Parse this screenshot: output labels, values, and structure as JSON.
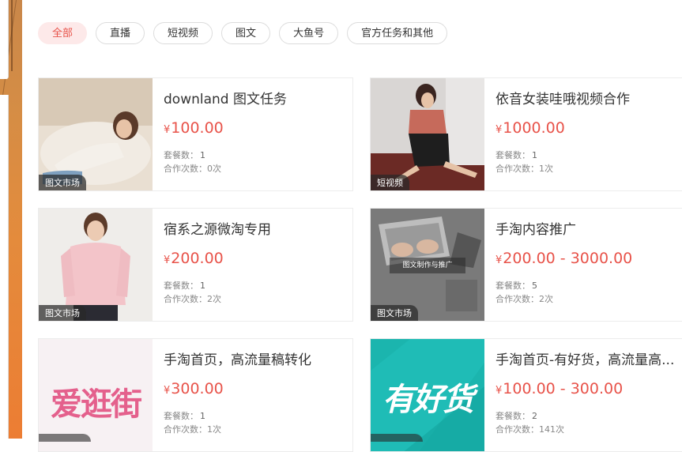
{
  "filters": [
    {
      "label": "全部",
      "active": true
    },
    {
      "label": "直播",
      "active": false
    },
    {
      "label": "短视频",
      "active": false
    },
    {
      "label": "图文",
      "active": false
    },
    {
      "label": "大鱼号",
      "active": false
    },
    {
      "label": "官方任务和其他",
      "active": false
    }
  ],
  "meta_labels": {
    "packages": "套餐数：",
    "times": "合作次数："
  },
  "currency": "¥",
  "cards": [
    {
      "title": "downland 图文任务",
      "price": "100.00",
      "packages": "1",
      "times": "0次",
      "tag": "图文市场"
    },
    {
      "title": "依音女装哇哦视频合作",
      "price": "1000.00",
      "packages": "1",
      "times": "1次",
      "tag": "短视频"
    },
    {
      "title": "宿系之源微淘专用",
      "price": "200.00",
      "packages": "1",
      "times": "2次",
      "tag": "图文市场"
    },
    {
      "title": "手淘内容推广",
      "price": "200.00 - 3000.00",
      "packages": "5",
      "times": "2次",
      "tag": "图文市场",
      "overlay_text": "图文制作与推广"
    },
    {
      "title": "手淘首页，高流量稿转化",
      "price": "300.00",
      "packages": "1",
      "times": "1次",
      "tag": "",
      "brand_text": "爱逛街"
    },
    {
      "title": "手淘首页-有好货，高流量高...",
      "price": "100.00 - 300.00",
      "packages": "2",
      "times": "141次",
      "tag": "",
      "brand_text": "有好货"
    }
  ],
  "colors": {
    "accent": "#e8534a",
    "active_pill_bg": "#fde9e9",
    "teal": "#19b7b0"
  }
}
